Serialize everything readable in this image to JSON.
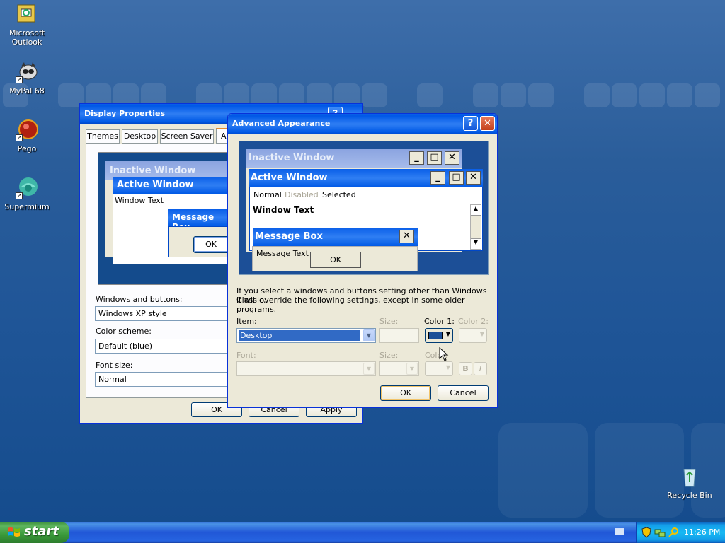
{
  "desktop": {
    "icons": [
      {
        "label": "Microsoft Outlook",
        "icon": "outlook-icon"
      },
      {
        "label": "MyPal 68",
        "icon": "mypal-icon"
      },
      {
        "label": "Pego",
        "icon": "pego-icon"
      },
      {
        "label": "Supermium",
        "icon": "supermium-icon"
      },
      {
        "label": "Recycle Bin",
        "icon": "recycle-bin-icon"
      }
    ]
  },
  "display_properties": {
    "title": "Display Properties",
    "tabs": [
      "Themes",
      "Desktop",
      "Screen Saver",
      "Ap"
    ],
    "preview": {
      "inactive_title": "Inactive Window",
      "active_title": "Active Window",
      "window_text": "Window Text",
      "message_box_title": "Message Box",
      "ok": "OK"
    },
    "windows_buttons_label": "Windows and buttons:",
    "windows_buttons_value": "Windows XP style",
    "color_scheme_label": "Color scheme:",
    "color_scheme_value": "Default (blue)",
    "font_size_label": "Font size:",
    "font_size_value": "Normal",
    "buttons": {
      "ok": "OK",
      "cancel": "Cancel",
      "apply": "Apply"
    }
  },
  "advanced_appearance": {
    "title": "Advanced Appearance",
    "preview": {
      "inactive_title": "Inactive Window",
      "active_title": "Active Window",
      "menu": [
        "Normal",
        "Disabled",
        "Selected"
      ],
      "window_text": "Window Text",
      "message_box_title": "Message Box",
      "message_text": "Message Text",
      "ok": "OK"
    },
    "info_line1": "If you select a windows and buttons setting other than Windows Classic,",
    "info_line2": "it will override the following settings, except in some older programs.",
    "item_label": "Item:",
    "item_value": "Desktop",
    "size_label": "Size:",
    "color1_label": "Color 1:",
    "color2_label": "Color 2:",
    "font_label": "Font:",
    "font_size_label": "Size:",
    "font_color_label": "Color:",
    "bold_label": "B",
    "italic_label": "I",
    "buttons": {
      "ok": "OK",
      "cancel": "Cancel"
    },
    "color1_value": "#1c4f97"
  },
  "taskbar": {
    "start_label": "start",
    "clock": "11:26 PM"
  }
}
